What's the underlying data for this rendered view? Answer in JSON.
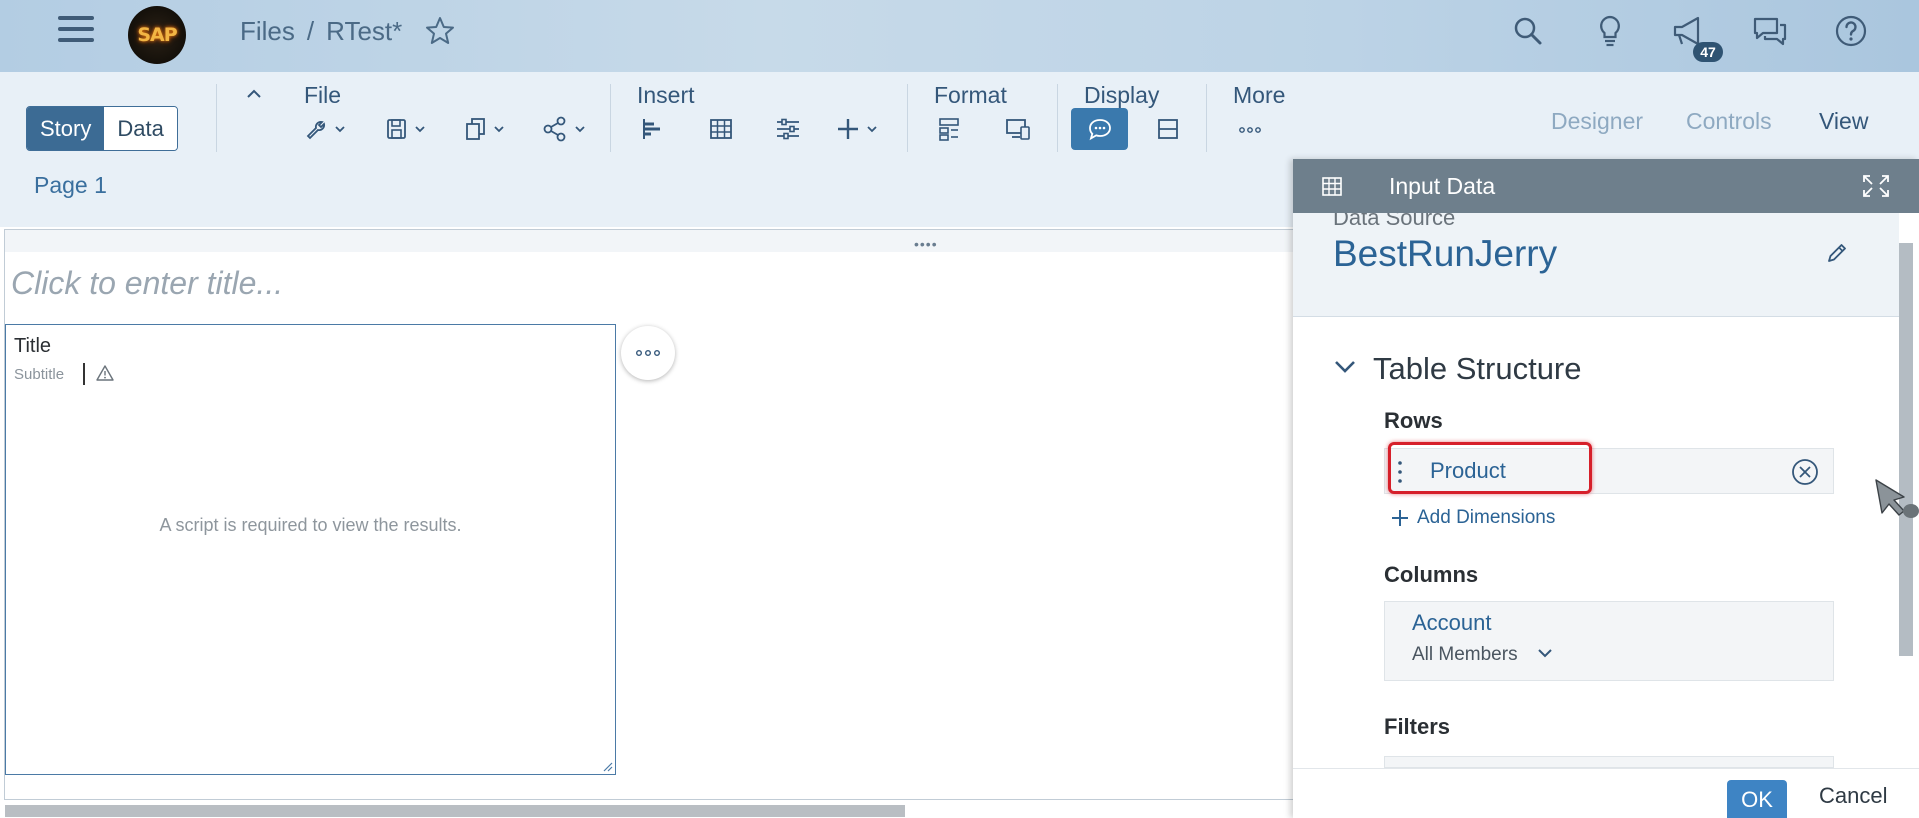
{
  "shell": {
    "breadcrumb_root": "Files",
    "breadcrumb_sep": "/",
    "breadcrumb_current": "RTest*",
    "notification_count": "47",
    "logo_text": "SAP",
    "icons": [
      "menu-icon",
      "search-icon",
      "lightbulb-icon",
      "megaphone-icon",
      "feedback-icon",
      "help-icon",
      "star-icon"
    ]
  },
  "toolbar": {
    "mode_story": "Story",
    "mode_data": "Data",
    "groups": {
      "file": "File",
      "insert": "Insert",
      "format": "Format",
      "display": "Display",
      "more": "More"
    },
    "right_tabs": {
      "designer": "Designer",
      "controls": "Controls",
      "view": "View"
    },
    "page_tab": "Page 1"
  },
  "canvas": {
    "title_placeholder": "Click to enter title...",
    "widget": {
      "title": "Title",
      "subtitle": "Subtitle",
      "message": "A script is required to view the results."
    }
  },
  "panel": {
    "header": "Input Data",
    "data_source_label": "Data Source",
    "data_source_name": "BestRunJerry",
    "section_title": "Table Structure",
    "rows_label": "Rows",
    "row_dimension": "Product",
    "add_dimensions": "Add Dimensions",
    "columns_label": "Columns",
    "column_dimension": "Account",
    "column_members": "All Members",
    "filters_label": "Filters",
    "ok": "OK",
    "cancel": "Cancel"
  },
  "colors": {
    "shell_bg": "#b3cde3",
    "accent": "#3c6b94",
    "link": "#2b6395",
    "panel_header": "#6e7f8c",
    "highlight_red": "#d61f2a",
    "ok_button": "#3e84c4"
  }
}
